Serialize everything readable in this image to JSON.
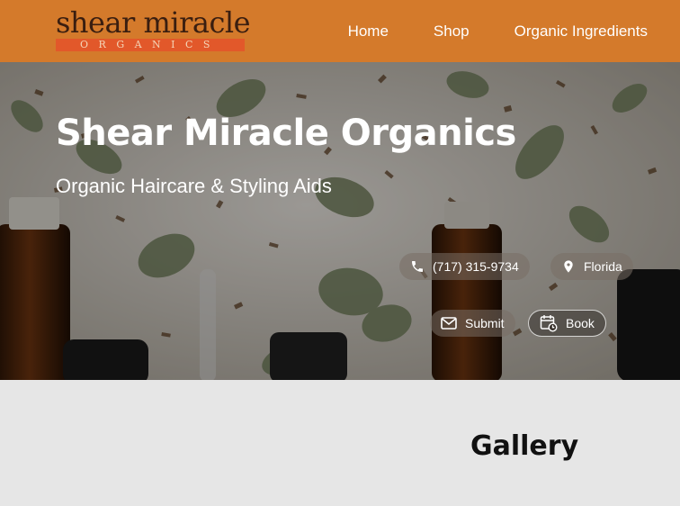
{
  "header": {
    "logo_top": "shear miracle",
    "logo_bottom": "ORGANICS",
    "nav": [
      "Home",
      "Shop",
      "Organic Ingredients"
    ]
  },
  "hero": {
    "title": "Shear Miracle Organics",
    "subtitle": "Organic Haircare & Styling Aids",
    "phone": "(717) 315-9734",
    "location": "Florida",
    "submit_label": "Submit",
    "book_label": "Book"
  },
  "gallery": {
    "title": "Gallery"
  },
  "colors": {
    "header_bg": "#d47a2b",
    "logo_band": "#e2582a",
    "page_bg": "#e6e6e6"
  },
  "icons": [
    "phone-icon",
    "location-pin-icon",
    "mail-icon",
    "calendar-icon"
  ]
}
